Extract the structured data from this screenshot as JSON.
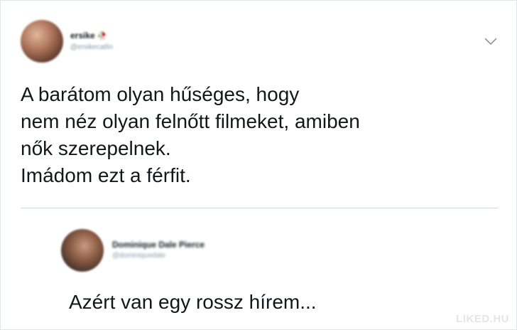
{
  "tweet": {
    "author": {
      "display_name": "ersike",
      "emoji": "🥀",
      "handle": "@ersikecatlin"
    },
    "menu_icon": "chevron-down-icon",
    "text_lines": [
      "A barátom olyan hűséges, hogy",
      "nem néz olyan felnőtt filmeket, amiben",
      "nők szerepelnek.",
      "Imádom ezt a férfit."
    ]
  },
  "reply": {
    "author": {
      "display_name": "Dominique Dale Pierce",
      "handle": "@dominiquedale"
    },
    "text": "Azért van egy rossz hírem..."
  },
  "watermark": "LIKED.HU",
  "colors": {
    "text": "#14171a",
    "muted": "#8899a6",
    "divider": "#d2d8dd",
    "caret": "#8899a6",
    "watermark": "#e3e6e8"
  }
}
